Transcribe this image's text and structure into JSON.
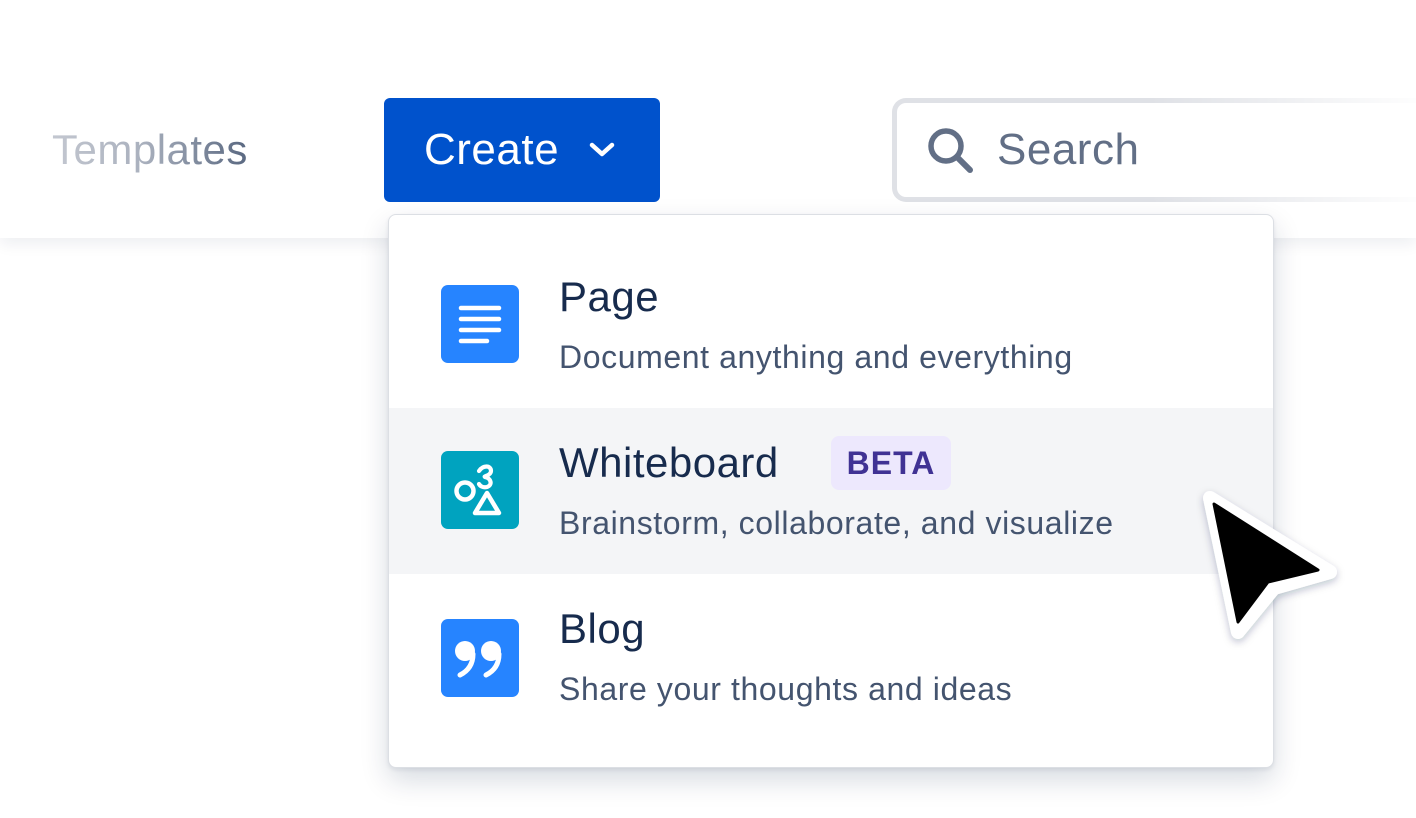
{
  "nav": {
    "templates_label": "Templates"
  },
  "create": {
    "label": "Create",
    "chevron_icon": "chevron-down-icon"
  },
  "search": {
    "placeholder": "Search",
    "icon": "search-icon"
  },
  "menu": {
    "items": [
      {
        "title": "Page",
        "description": "Document anything and everything",
        "icon": "page-lines-icon",
        "icon_color": "#2684ff"
      },
      {
        "title": "Whiteboard",
        "badge": "BETA",
        "description": "Brainstorm, collaborate, and visualize",
        "icon": "whiteboard-shapes-icon",
        "icon_color": "#00a3bf",
        "hovered": true
      },
      {
        "title": "Blog",
        "description": "Share your thoughts and ideas",
        "icon": "quote-icon",
        "icon_color": "#2684ff"
      }
    ]
  },
  "colors": {
    "primary": "#0052cc",
    "hover_bg": "#f4f5f7",
    "badge_bg": "#ede8fd",
    "badge_text": "#403294",
    "title_text": "#172b4d",
    "desc_text": "#44546f"
  }
}
